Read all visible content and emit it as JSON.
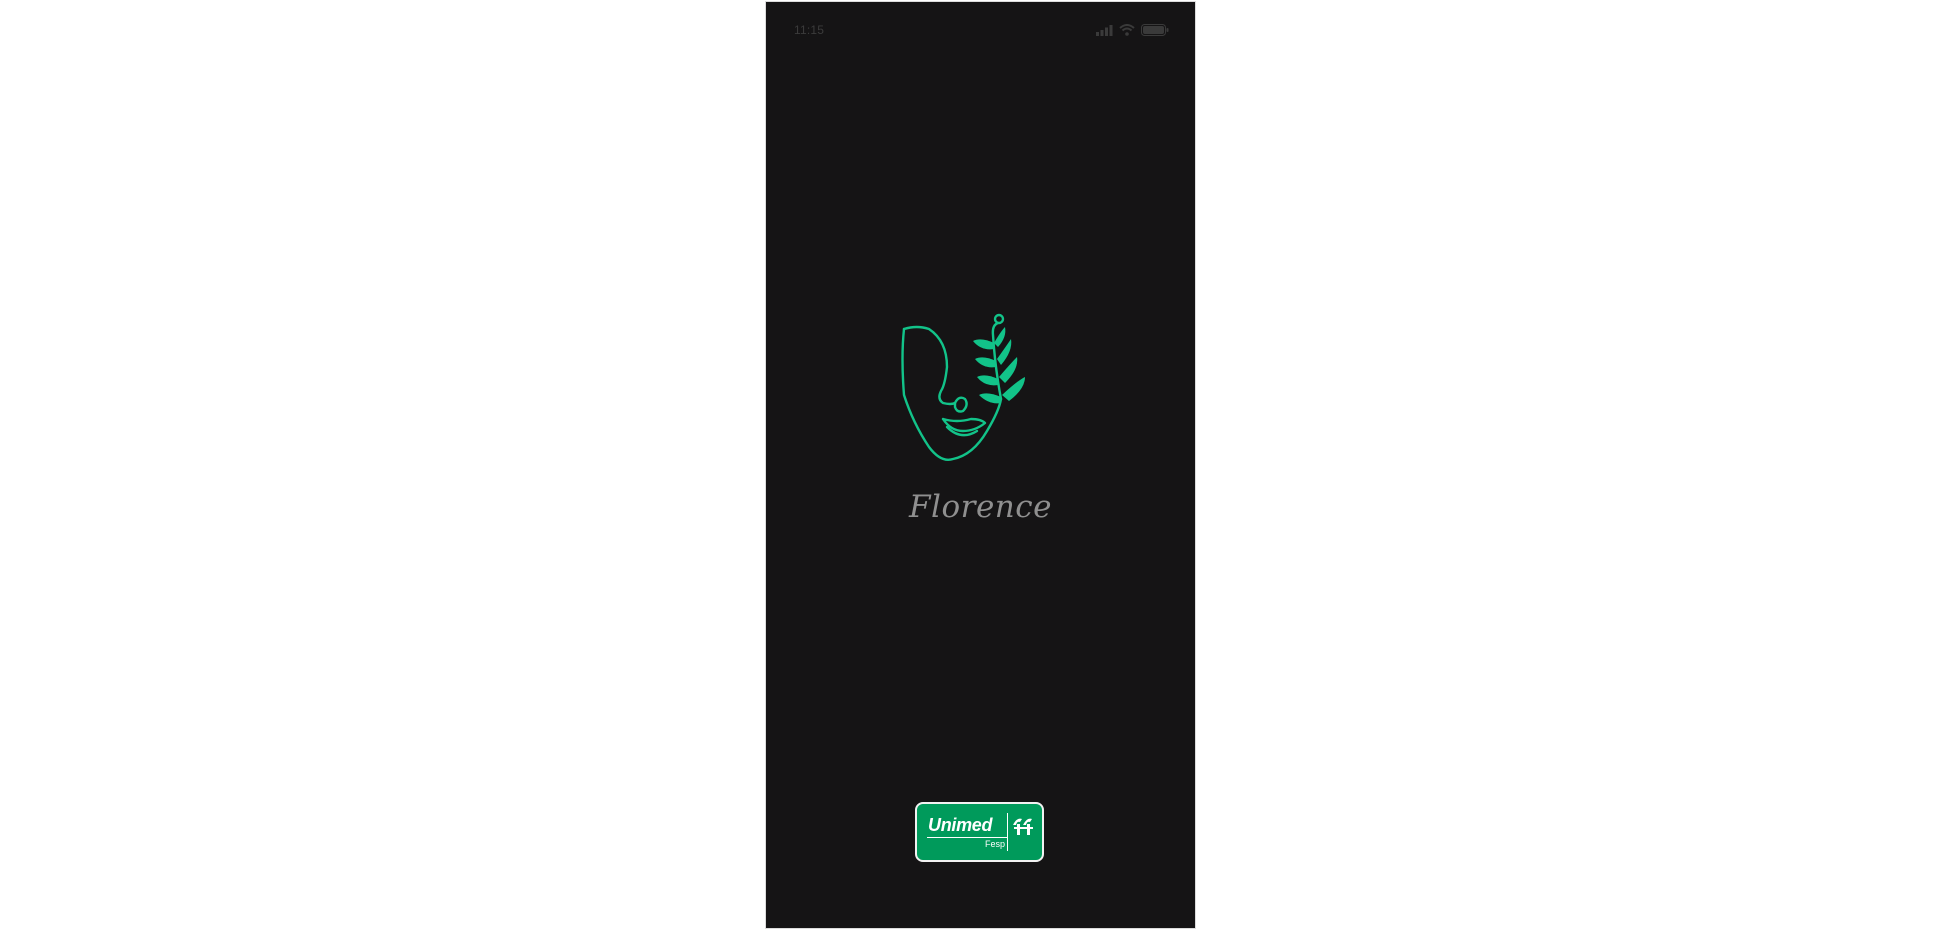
{
  "status_bar": {
    "time": "11:15",
    "icons": [
      "cellular-signal-icon",
      "wifi-icon",
      "battery-icon"
    ]
  },
  "splash": {
    "logo_icon": "face-leaf-line-art-icon",
    "app_name": "Florence"
  },
  "partner": {
    "brand_name": "Unimed",
    "sub_label": "Fesp",
    "logo_icon": "unimed-tree-logo-icon"
  },
  "colors": {
    "background": "#151415",
    "accent_green": "#12c389",
    "app_name_text": "#8f8f8f",
    "partner_green": "#009a5b"
  }
}
